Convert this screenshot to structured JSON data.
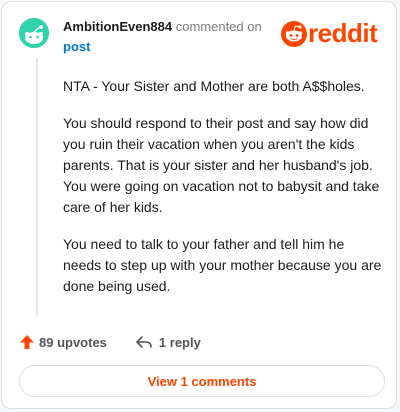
{
  "comment": {
    "username": "AmbitionEven884",
    "action_text": "commented on",
    "post_link": "post",
    "paragraphs": [
      "NTA - Your Sister and Mother are both A$$holes.",
      "You should respond to their post and say how did you ruin their vacation when you aren't the kids parents. That is your sister and her husband's job. You were going on vacation not to babysit and take care of her kids.",
      "You need to talk to your father and tell him he needs to step up with your mother because you are done being used."
    ]
  },
  "brand": {
    "word": "reddit",
    "logo_icon": "reddit-snoo-icon",
    "color": "#ff4500"
  },
  "avatar": {
    "icon": "snoo-avatar-icon",
    "color": "#2ed3ad"
  },
  "actions": {
    "upvotes": "89 upvotes",
    "upvote_icon": "upvote-arrow-icon",
    "reply": "1 reply",
    "reply_icon": "reply-arrow-icon"
  },
  "footer": {
    "view_comments": "View 1 comments"
  }
}
